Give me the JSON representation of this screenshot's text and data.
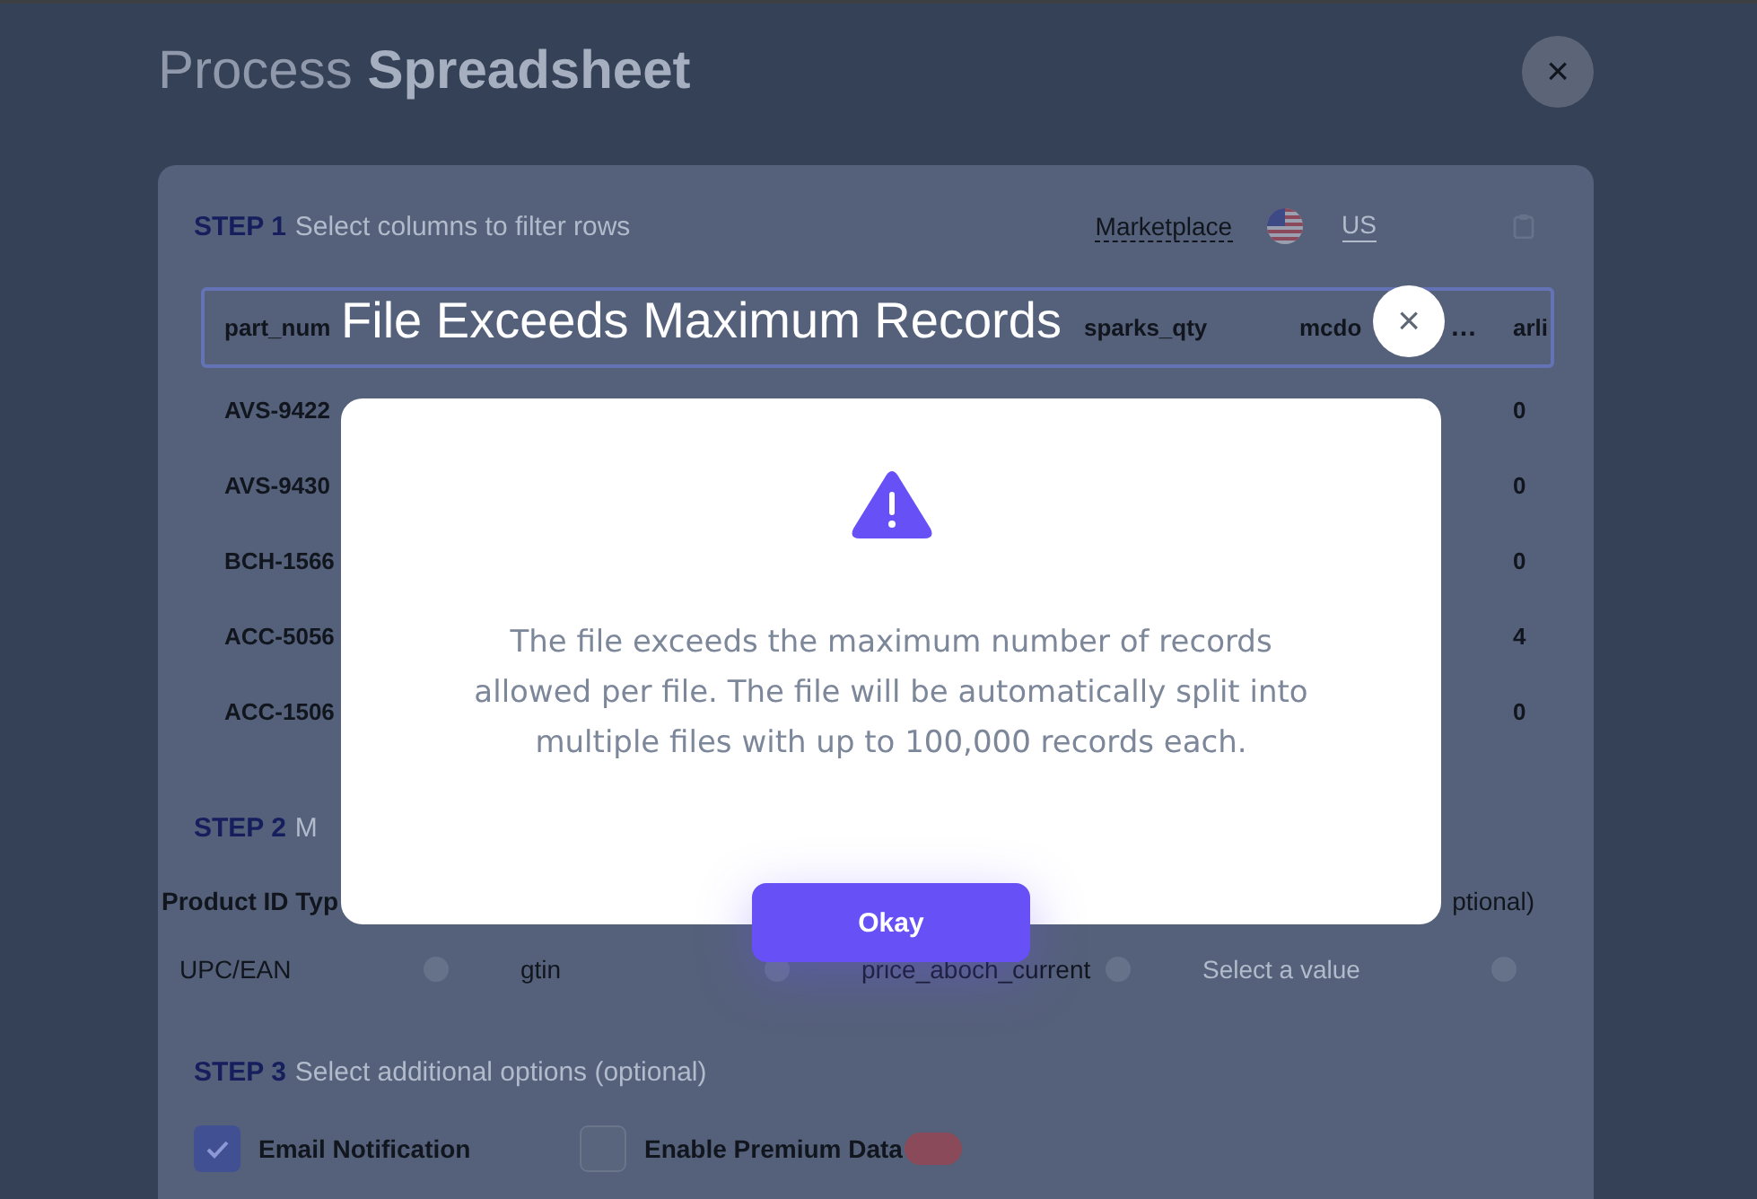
{
  "header": {
    "title": "Process **Spreadsheet**",
    "close": "×"
  },
  "step1": {
    "step": "STEP 1",
    "description": "Select columns to filter rows",
    "marketplace_label": "Marketplace",
    "marketplace_value": "US"
  },
  "table": {
    "columns": [
      {
        "label": "part_num"
      },
      {
        "label": "sparks_qty"
      },
      {
        "label": "mcdo",
        "overflow": "…"
      },
      {
        "label": "arli"
      }
    ],
    "rows": [
      {
        "cells": [
          "AVS-9422",
          "0"
        ]
      },
      {
        "cells": [
          "AVS-9430",
          "0"
        ]
      },
      {
        "cells": [
          "BCH-1566",
          "0"
        ]
      },
      {
        "cells": [
          "ACC-5056",
          "4"
        ]
      },
      {
        "cells": [
          "ACC-1506",
          "0"
        ]
      }
    ]
  },
  "step2": {
    "step": "STEP 2",
    "description": "M",
    "labels": [
      "Product ID Typ",
      "ptional)"
    ],
    "fields": [
      {
        "value": "UPC/EAN"
      },
      {
        "value": "gtin"
      },
      {
        "value": "price_aboch_current"
      },
      {
        "placeholder": "Select a value"
      }
    ]
  },
  "step3": {
    "step": "STEP 3",
    "description": "Select additional options (optional)",
    "options": [
      {
        "label": "Email Notification",
        "checked": true
      },
      {
        "label": "Enable Premium Data",
        "checked": false,
        "badge": true
      }
    ]
  },
  "modal": {
    "title": "File Exceeds Maximum Records",
    "close": "×",
    "message": "The file exceeds the maximum number of records allowed per file. The file will be automatically split into multiple files with up to 100,000 records each.",
    "button": "Okay"
  }
}
